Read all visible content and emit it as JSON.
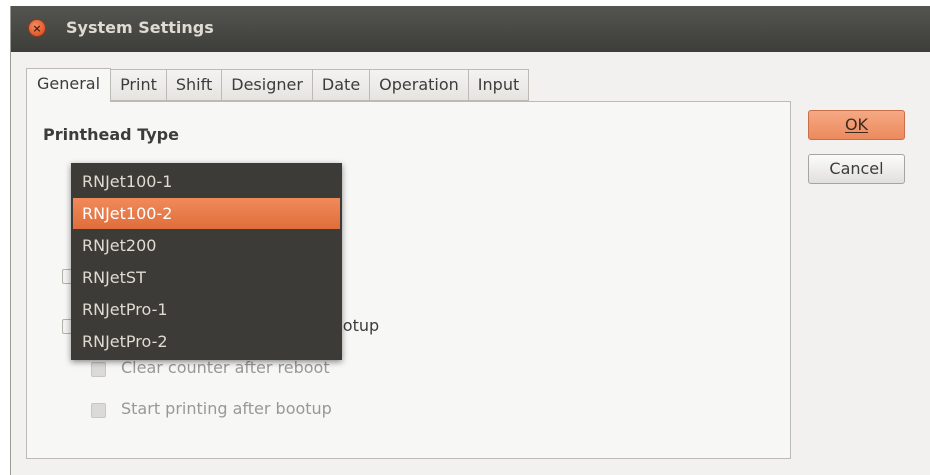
{
  "window": {
    "title": "System Settings"
  },
  "tabs": [
    {
      "label": "General",
      "active": true
    },
    {
      "label": "Print"
    },
    {
      "label": "Shift"
    },
    {
      "label": "Designer"
    },
    {
      "label": "Date"
    },
    {
      "label": "Operation"
    },
    {
      "label": "Input"
    }
  ],
  "general": {
    "section_title": "Printhead Type",
    "partial_checkbox_text": "ootup",
    "options": [
      {
        "label": "Clear counter after reboot",
        "checked": false,
        "enabled": false
      },
      {
        "label": "Start printing after bootup",
        "checked": false,
        "enabled": false
      }
    ]
  },
  "dropdown": {
    "selected": "RNJet100-2",
    "items": [
      "RNJet100-1",
      "RNJet100-2",
      "RNJet200",
      "RNJetST",
      "RNJetPro-1",
      "RNJetPro-2"
    ]
  },
  "buttons": {
    "ok": "OK",
    "cancel": "Cancel"
  },
  "colors": {
    "accent": "#e9753f",
    "titlebar": "#3c3b37",
    "window_bg": "#f2f1f0"
  }
}
